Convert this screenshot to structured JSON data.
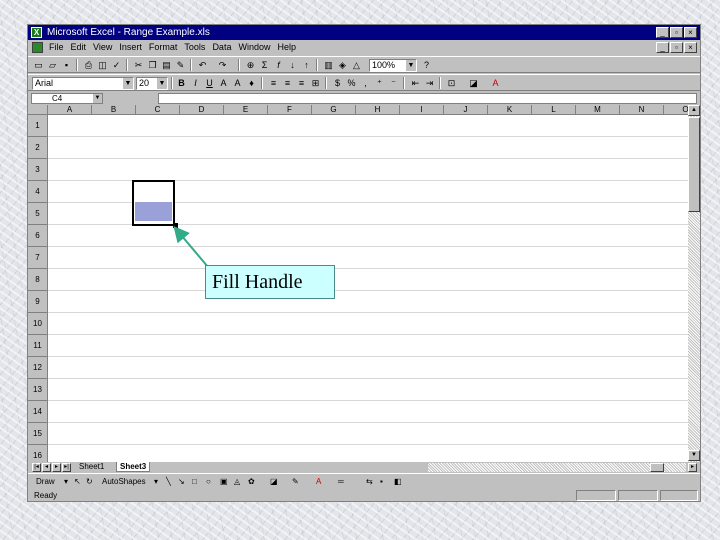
{
  "titlebar": {
    "title": "Microsoft Excel - Range Example.xls",
    "min": "_",
    "max": "▫",
    "close": "×"
  },
  "menubar": {
    "items": [
      "File",
      "Edit",
      "View",
      "Insert",
      "Format",
      "Tools",
      "Data",
      "Window",
      "Help"
    ]
  },
  "toolbar": {
    "zoom": "100%",
    "sigma": "Σ",
    "fx": "f"
  },
  "formatting": {
    "font": "Arial",
    "size": "20",
    "bold": "B",
    "italic": "I",
    "underline": "U",
    "percent": "%",
    "comma": ",",
    "currency": "$"
  },
  "formula_bar": {
    "name_box": "C4",
    "formula": ""
  },
  "columns": [
    "A",
    "B",
    "C",
    "D",
    "E",
    "F",
    "G",
    "H",
    "I",
    "J",
    "K",
    "L",
    "M",
    "N",
    "O"
  ],
  "rows": [
    "1",
    "2",
    "3",
    "4",
    "5",
    "6",
    "7",
    "8",
    "9",
    "10",
    "11",
    "12",
    "13",
    "14",
    "15",
    "16"
  ],
  "callout": {
    "text": "Fill Handle"
  },
  "sheets": [
    {
      "name": "Sheet1",
      "active": false
    },
    {
      "name": "Sheet3",
      "active": true
    }
  ],
  "drawing": {
    "draw": "Draw",
    "autoshapes": "AutoShapes"
  },
  "status": {
    "text": "Ready"
  },
  "colors": {
    "title_bar": "#000080",
    "callout_fill": "#ccffff",
    "arrow": "#33aa88",
    "selection_fill": "#9aa0d8"
  }
}
